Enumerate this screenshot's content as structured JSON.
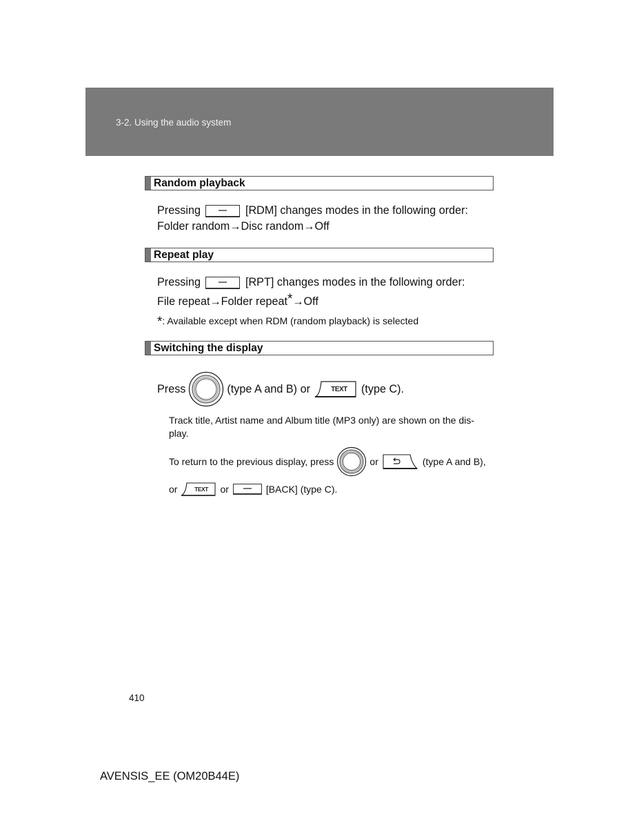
{
  "header": {
    "chapter": "3-2. Using the audio system"
  },
  "sections": {
    "random": {
      "title": "Random playback",
      "line1_pre": "Pressing",
      "line1_post": "[RDM] changes modes in the following order:",
      "line2": "Folder random→Disc random→Off",
      "button_icon": "rect-button-icon"
    },
    "repeat": {
      "title": "Repeat play",
      "line1_pre": "Pressing",
      "line1_post": "[RPT] changes modes in the following order:",
      "line2_a": "File repeat→Folder repeat",
      "line2_star": "*",
      "line2_b": "→Off",
      "note_star": "*",
      "note": ": Available except when RDM (random playback) is selected"
    },
    "display": {
      "title": "Switching the display",
      "press": "Press",
      "type_ab_or": "(type A and B) or",
      "text_btn": "TEXT",
      "type_c": "(type C).",
      "info": "Track title, Artist name and Album title (MP3 only) are shown on the dis-",
      "info_cont": "play.",
      "return_pre": "To return to the previous display, press",
      "or1": "or",
      "type_ab": "(type A and B),",
      "or2": "or",
      "or3": "or",
      "back": "[BACK] (type C)."
    }
  },
  "footer": {
    "page_number": "410",
    "model": "AVENSIS_EE (OM20B44E)"
  }
}
